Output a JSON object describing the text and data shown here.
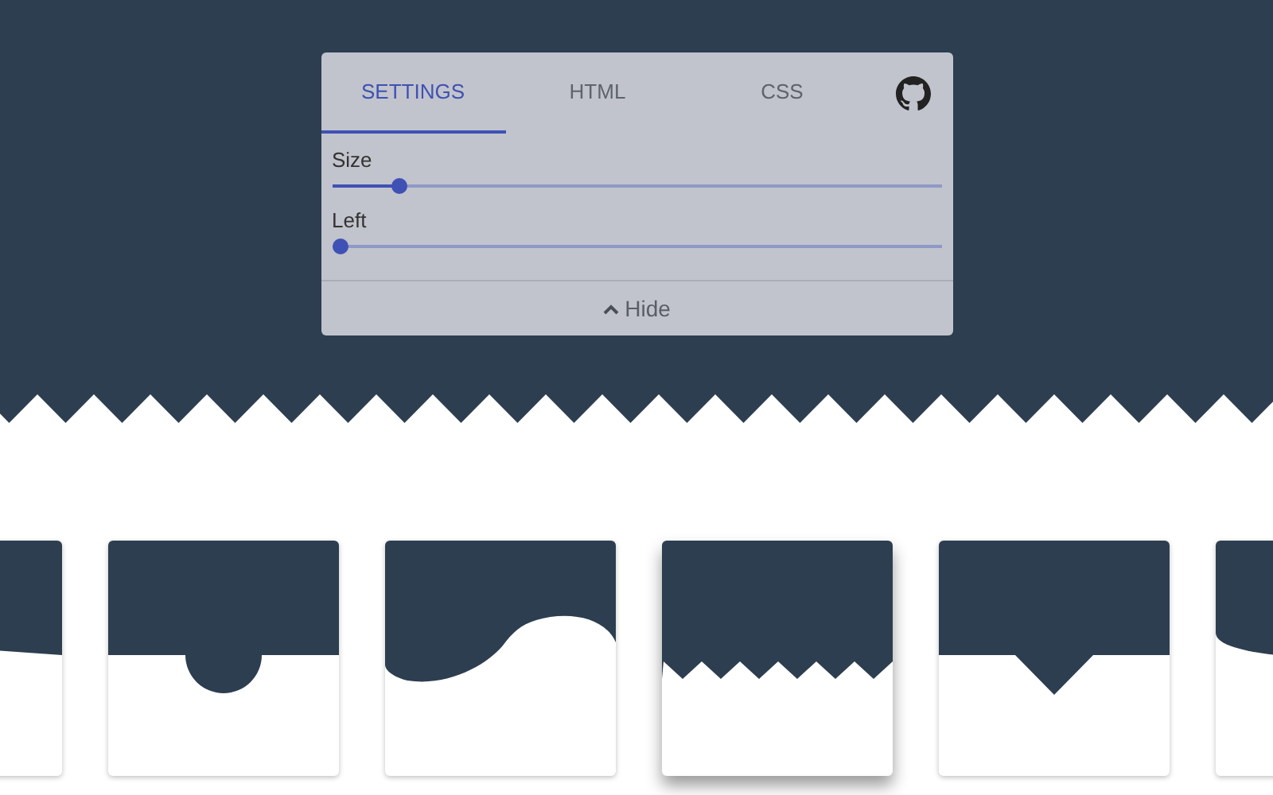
{
  "panel": {
    "tabs": [
      {
        "label": "SETTINGS",
        "selected": true
      },
      {
        "label": "HTML",
        "selected": false
      },
      {
        "label": "CSS",
        "selected": false
      }
    ],
    "sliders": [
      {
        "label": "Size",
        "level": 0.1
      },
      {
        "label": "Left",
        "level": 0
      }
    ],
    "hide_button": {
      "label": "Hide"
    }
  },
  "presets": [
    {
      "kind": "slant",
      "selected": false
    },
    {
      "kind": "circle",
      "selected": false
    },
    {
      "kind": "wave",
      "selected": false
    },
    {
      "kind": "zigzag",
      "selected": true
    },
    {
      "kind": "triangle",
      "selected": false
    },
    {
      "kind": "curve",
      "selected": false
    }
  ]
}
